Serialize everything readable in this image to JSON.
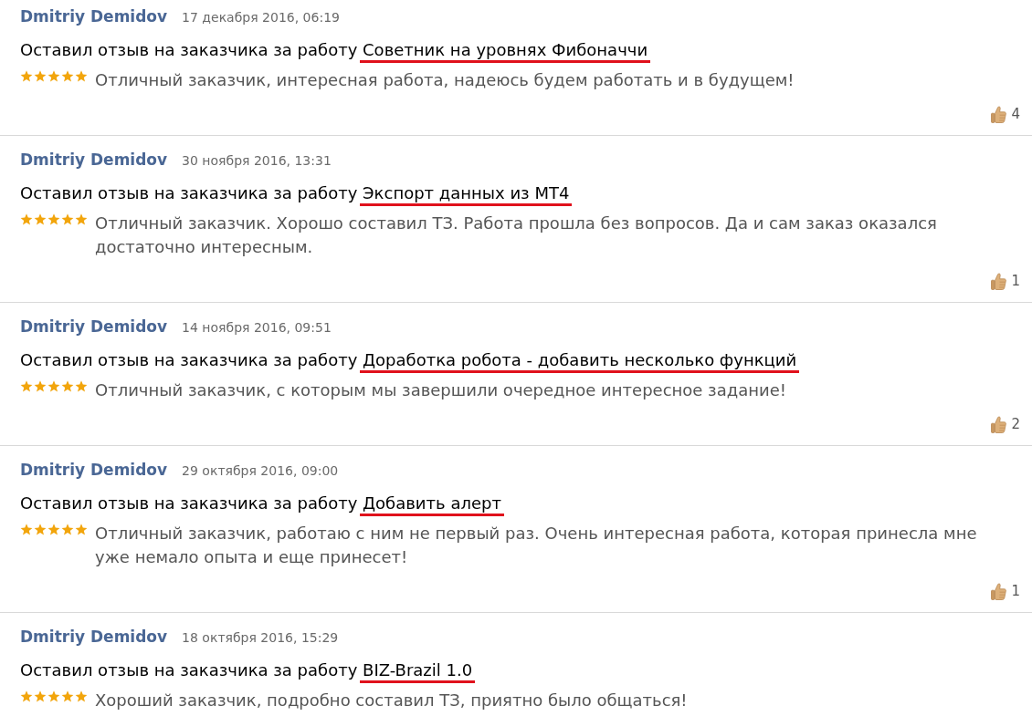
{
  "reviews": [
    {
      "author": "Dmitriy Demidov",
      "date": "17 декабря 2016, 06:19",
      "action": "Оставил отзыв на заказчика за работу",
      "project": "Советник на уровнях Фибоначчи",
      "underlined": true,
      "stars": 5,
      "comment": "Отличный заказчик, интересная работа, надеюсь будем работать и в будущем!",
      "likes": "4"
    },
    {
      "author": "Dmitriy Demidov",
      "date": "30 ноября 2016, 13:31",
      "action": "Оставил отзыв на заказчика за работу",
      "project": "Экспорт данных из MT4",
      "underlined": true,
      "stars": 5,
      "comment": "Отличный заказчик. Хорошо составил ТЗ. Работа прошла без вопросов. Да и сам заказ оказался достаточно интересным.",
      "likes": "1"
    },
    {
      "author": "Dmitriy Demidov",
      "date": "14 ноября 2016, 09:51",
      "action": "Оставил отзыв на заказчика за работу",
      "project": "Доработка робота - добавить несколько функций",
      "underlined": true,
      "stars": 5,
      "comment": "Отличный заказчик, с которым мы завершили очередное интересное задание!",
      "likes": "2"
    },
    {
      "author": "Dmitriy Demidov",
      "date": "29 октября 2016, 09:00",
      "action": "Оставил отзыв на заказчика за работу",
      "project": "Добавить алерт",
      "underlined": true,
      "stars": 5,
      "comment": "Отличный заказчик, работаю с ним не первый раз. Очень интересная работа, которая принесла мне уже немало опыта и еще принесет!",
      "likes": "1"
    },
    {
      "author": "Dmitriy Demidov",
      "date": "18 октября 2016, 15:29",
      "action": "Оставил отзыв на заказчика за работу",
      "project": "BIZ-Brazil 1.0",
      "underlined": true,
      "stars": 5,
      "comment": "Хороший заказчик, подробно составил ТЗ, приятно было общаться!"
    }
  ]
}
